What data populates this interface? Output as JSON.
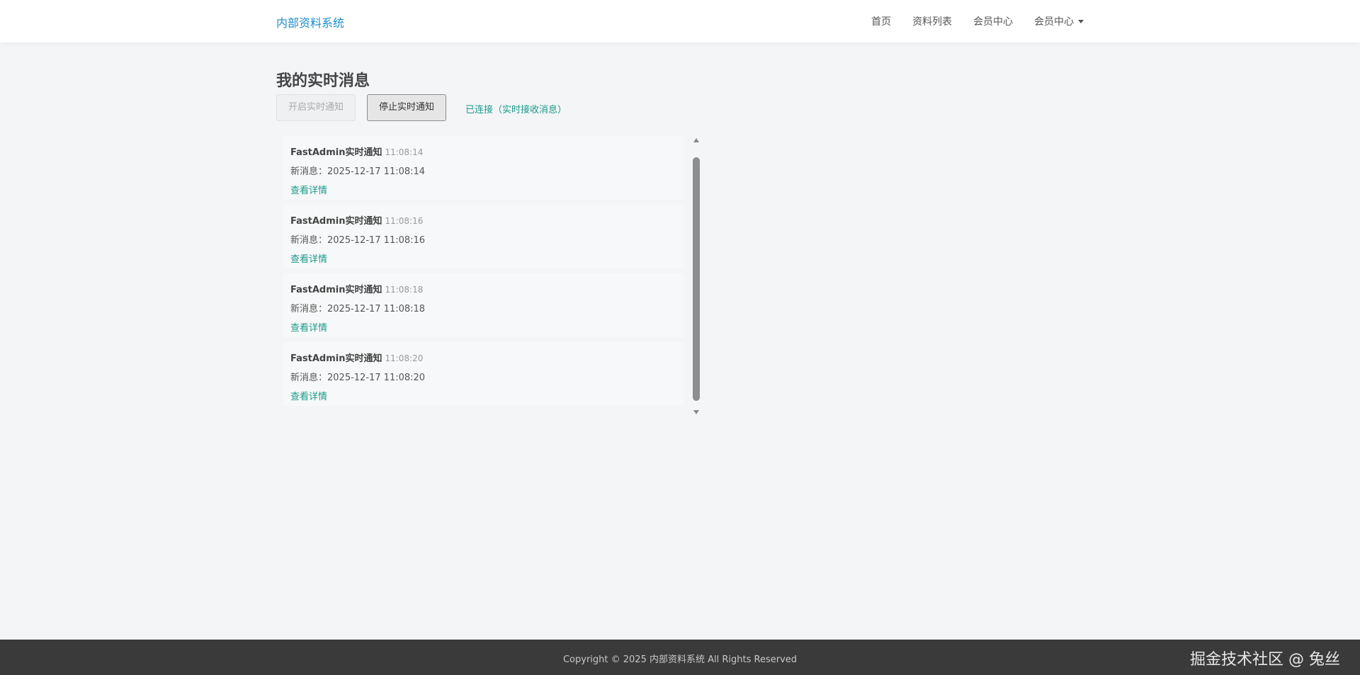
{
  "navbar": {
    "brand": "内部资料系统",
    "items": [
      {
        "label": "首页"
      },
      {
        "label": "资料列表"
      },
      {
        "label": "会员中心"
      },
      {
        "label": "会员中心"
      }
    ]
  },
  "page": {
    "title": "我的实时消息",
    "start_button": "开启实时通知",
    "stop_button": "停止实时通知",
    "connection_status": "已连接（实时接收消息）"
  },
  "messages": [
    {
      "sender": "FastAdmin实时通知",
      "time": "11:08:14",
      "body": "新消息：2025-12-17 11:08:14",
      "link": "查看详情"
    },
    {
      "sender": "FastAdmin实时通知",
      "time": "11:08:16",
      "body": "新消息：2025-12-17 11:08:16",
      "link": "查看详情"
    },
    {
      "sender": "FastAdmin实时通知",
      "time": "11:08:18",
      "body": "新消息：2025-12-17 11:08:18",
      "link": "查看详情"
    },
    {
      "sender": "FastAdmin实时通知",
      "time": "11:08:20",
      "body": "新消息：2025-12-17 11:08:20",
      "link": "查看详情"
    }
  ],
  "footer": {
    "copyright": "Copyright © 2025 内部资料系统 All Rights Reserved",
    "watermark": "掘金技术社区 @ 兔丝"
  },
  "colors": {
    "brand": "#1c8ec8",
    "link": "#1b9a89",
    "footer_bg": "#3a3a3a",
    "page_bg": "#f3f5f7"
  },
  "icons": [
    "caret-down-icon",
    "scroll-up-arrow-icon",
    "scroll-down-arrow-icon"
  ]
}
